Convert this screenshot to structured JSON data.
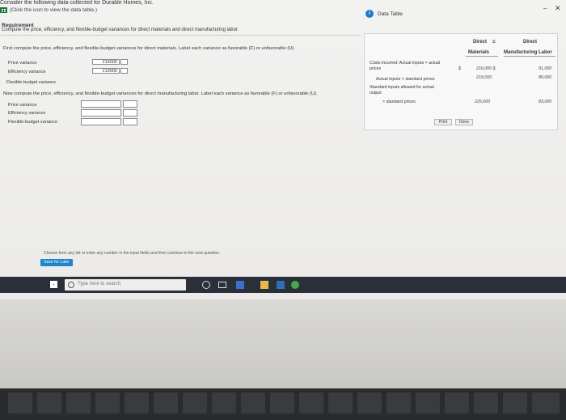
{
  "header": {
    "title": "Consider the following data collected for Durable Homes, Inc.",
    "hint": "(Click the icon to view the data table.)"
  },
  "requirement": {
    "label": "Requirement",
    "text": "Compute the price, efficiency, and flexible-budget variances for direct materials and direct manufacturing labor."
  },
  "materials_section": {
    "instruction": "First compute the price, efficiency, and flexible-budget variances for direct materials. Label each variance as favorable (F) or unfavorable (U).",
    "rows": [
      {
        "label": "Price variance",
        "value": "216000"
      },
      {
        "label": "Efficiency variance",
        "value": "219000"
      },
      {
        "label": "Flexible-budget variance",
        "value": ""
      }
    ]
  },
  "labor_section": {
    "instruction": "Now compute the price, efficiency, and flexible-budget variances for direct manufacturing labor. Label each variance as favorable (F) or unfavorable (U).",
    "rows": [
      {
        "label": "Price variance"
      },
      {
        "label": "Efficiency variance"
      },
      {
        "label": "Flexible-budget variance"
      }
    ]
  },
  "footer_hint": "Choose from any list or enter any number in the input fields and then continue to the next question.",
  "save_button": "Save for Later",
  "data_table": {
    "title": "Data Table",
    "col_headers": [
      {
        "line1": "Direct",
        "line2": "Materials"
      },
      {
        "line1": "Direct",
        "line2": "Manufacturing Labor"
      }
    ],
    "rows": [
      {
        "label1": "Costs incurred: Actual inputs × actual",
        "label2": "prices",
        "dollar": "$",
        "materials": "216,000 $",
        "labor": "91,000"
      },
      {
        "label1": "Actual inputs × standard prices",
        "label2": "",
        "dollar": "",
        "materials": "219,000",
        "labor": "80,000"
      },
      {
        "label1": "Standard inputs allowed for actual",
        "label2": "output",
        "dollar": "",
        "materials": "",
        "labor": ""
      },
      {
        "label1": "× standard prices",
        "label2": "",
        "dollar": "",
        "materials": "225,000",
        "labor": "83,000"
      }
    ],
    "print_label": "Print",
    "done_label": "Done"
  },
  "taskbar": {
    "search_placeholder": "Type here to search"
  },
  "window_controls": {
    "minimize": "–",
    "close": "✕"
  },
  "colors": {
    "accent": "#1a7ac6",
    "taskbar": "#2b2f3a"
  }
}
